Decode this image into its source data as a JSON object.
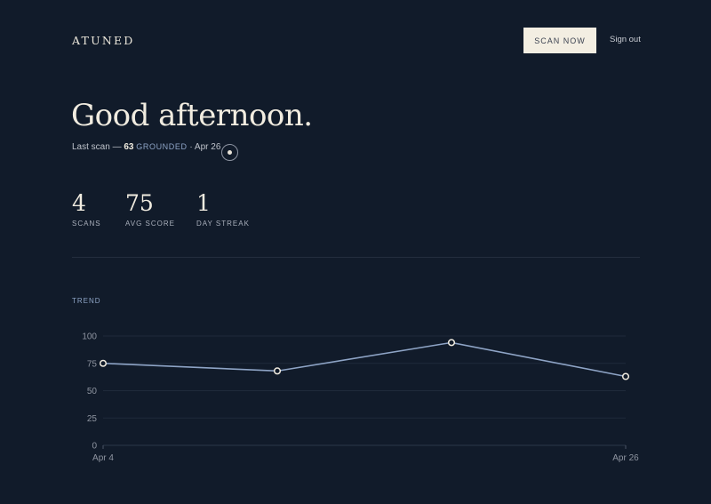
{
  "header": {
    "brand": "ATUNED",
    "scan_button": "SCAN NOW",
    "signout": "Sign out"
  },
  "hero": {
    "greeting": "Good afternoon.",
    "last_scan_prefix": "Last scan —",
    "last_scan_score": "63",
    "last_scan_state": "GROUNDED",
    "last_scan_date": "· Apr 26"
  },
  "stats": [
    {
      "value": "4",
      "label": "SCANS"
    },
    {
      "value": "75",
      "label": "AVG SCORE"
    },
    {
      "value": "1",
      "label": "DAY STREAK"
    }
  ],
  "trend_label": "TREND",
  "colors": {
    "background": "#111b2a",
    "line": "#8ea4c6",
    "accent_button": "#f3eee2"
  },
  "chart_data": {
    "type": "line",
    "title": "",
    "xlabel": "",
    "ylabel": "",
    "x": [
      "Apr 4",
      "",
      "",
      "Apr 26"
    ],
    "x_tick_labels": [
      "Apr 4",
      "Apr 26"
    ],
    "values": [
      75,
      68,
      94,
      63
    ],
    "ylim": [
      0,
      100
    ],
    "yticks": [
      0,
      25,
      50,
      75,
      100
    ],
    "grid": true,
    "legend": "none"
  }
}
